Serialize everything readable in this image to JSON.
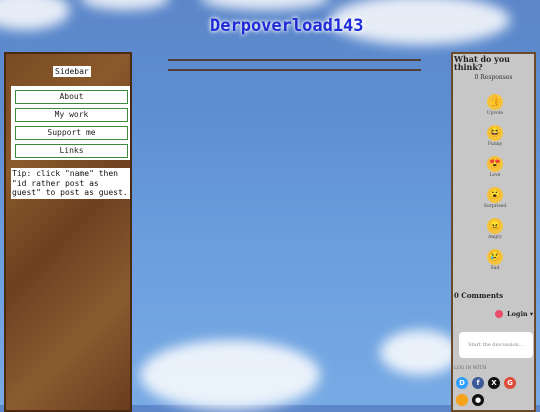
{
  "site": {
    "title": "Derpoverload143"
  },
  "sidebar": {
    "title": "Sidebar",
    "items": [
      {
        "label": "About"
      },
      {
        "label": "My work"
      },
      {
        "label": "Support me"
      },
      {
        "label": "Links"
      }
    ],
    "tip": "Tip: click \"name\" then \"id rather post as guest\" to post as guest."
  },
  "comments": {
    "title": "What do you think?",
    "responses": "0 Responses",
    "reactions": [
      {
        "label": "Upvote",
        "icon": "thumbs-up",
        "glyph": "👍"
      },
      {
        "label": "Funny",
        "icon": "laughing-face",
        "glyph": "😆"
      },
      {
        "label": "Love",
        "icon": "heart-eyes-face",
        "glyph": "😍"
      },
      {
        "label": "Surprised",
        "icon": "surprised-face",
        "glyph": "😮"
      },
      {
        "label": "Angry",
        "icon": "angry-face",
        "glyph": "😠"
      },
      {
        "label": "Sad",
        "icon": "sad-face",
        "glyph": "😢"
      }
    ],
    "count": "0 Comments",
    "login": "Login ▾",
    "placeholder": "Start the discussion…",
    "log_in_with": "LOG IN WITH",
    "providers": [
      {
        "label": "D",
        "name": "disqus",
        "color": "#2e9fff"
      },
      {
        "label": "f",
        "name": "facebook",
        "color": "#3b5998"
      },
      {
        "label": "X",
        "name": "x",
        "color": "#111111"
      },
      {
        "label": "G",
        "name": "google",
        "color": "#dd4b39"
      }
    ]
  }
}
